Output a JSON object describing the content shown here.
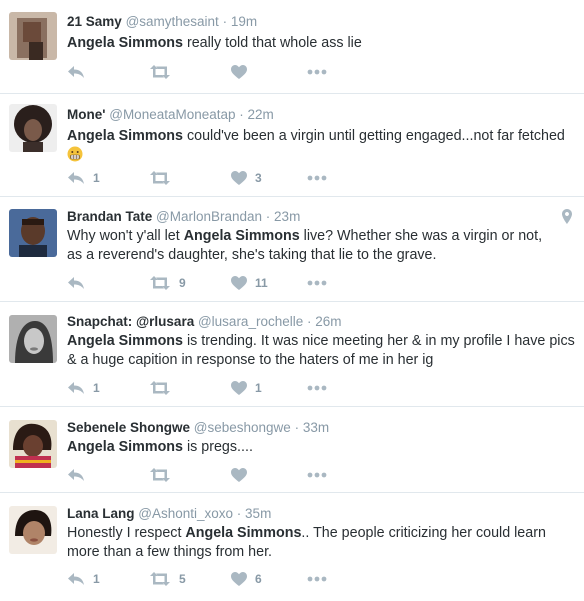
{
  "tweets": [
    {
      "name": "21 Samy",
      "handle": "@samythesaint",
      "sep": " · ",
      "time": "19m",
      "text_pre": "",
      "text_bold": "Angela Simmons",
      "text_post": " really told that whole ass lie",
      "text_line2": "",
      "replies": "",
      "retweets": "",
      "likes": "",
      "avatar_color": "#6b4a3a"
    },
    {
      "name": "Mone'",
      "handle": "@MoneataMoneatap",
      "sep": " · ",
      "time": "22m",
      "text_pre": "",
      "text_bold": "Angela Simmons",
      "text_post": " could've been a virgin until getting engaged...not far fetched",
      "text_line2": "",
      "emoji": "grimacing-emoji",
      "replies": "1",
      "retweets": "",
      "likes": "3",
      "avatar_color": "#3b2e2a"
    },
    {
      "name": "Brandan Tate",
      "handle": "@MarlonBrandan",
      "sep": " · ",
      "time": "23m",
      "text_pre": "Why won't y'all let ",
      "text_bold": "Angela Simmons",
      "text_post": " live? Whether she was a virgin or not,",
      "text_line2": "as a reverend's daughter, she's taking that lie to the grave.",
      "replies": "",
      "retweets": "9",
      "likes": "11",
      "avatar_color": "#2d3a52"
    },
    {
      "name": "Snapchat: @rlusara",
      "handle": "@lusara_rochelle",
      "sep": " · ",
      "time": "26m",
      "text_pre": "",
      "text_bold": "Angela Simmons",
      "text_post": " is trending. It was nice meeting her & in my profile I have pics",
      "text_line2": "& a huge capition in response to the haters of me in her ig",
      "replies": "1",
      "retweets": "",
      "likes": "1",
      "avatar_color": "#8a8a8a"
    },
    {
      "name": "Sebenele Shongwe",
      "handle": "@sebeshongwe",
      "sep": " · ",
      "time": "33m",
      "text_pre": "",
      "text_bold": "Angela Simmons",
      "text_post": " is pregs....",
      "text_line2": "",
      "replies": "",
      "retweets": "",
      "likes": "",
      "avatar_color": "#7a3a6a"
    },
    {
      "name": "Lana Lang",
      "handle": "@Ashonti_xoxo",
      "sep": " · ",
      "time": "35m",
      "text_pre": "Honestly I respect ",
      "text_bold": "Angela Simmons",
      "text_post": ".. The people criticizing her could learn",
      "text_line2": "more than a few things from her.",
      "replies": "1",
      "retweets": "5",
      "likes": "6",
      "avatar_color": "#d9c6b4"
    }
  ],
  "colors": {
    "action_icon": "#aab8c2",
    "muted_text": "#8899a6",
    "divider": "#e1e8ed"
  }
}
